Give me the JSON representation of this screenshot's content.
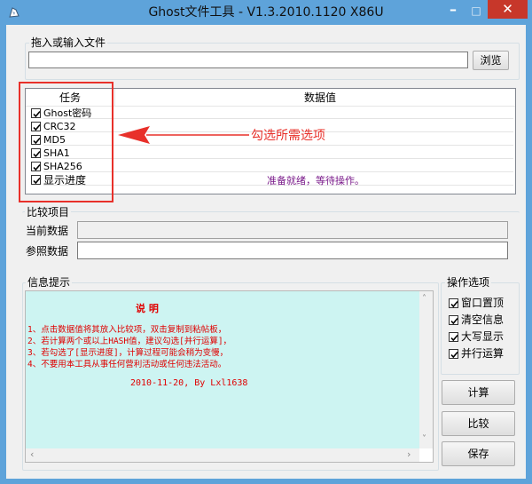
{
  "window": {
    "title": "Ghost文件工具 - V1.3.2010.1120 X86U",
    "minimize": "–",
    "maximize": "□",
    "close": "✕"
  },
  "file": {
    "group_label": "拖入或输入文件",
    "path_value": "",
    "browse_label": "浏览"
  },
  "task_list": {
    "col_task": "任务",
    "col_value": "数据值",
    "items": [
      {
        "label": "Ghost密码",
        "checked": true
      },
      {
        "label": "CRC32",
        "checked": true
      },
      {
        "label": "MD5",
        "checked": true
      },
      {
        "label": "SHA1",
        "checked": true
      },
      {
        "label": "SHA256",
        "checked": true
      },
      {
        "label": "显示进度",
        "checked": true
      }
    ],
    "status": "准备就绪，等待操作。"
  },
  "annotation": {
    "text": "勾选所需选项",
    "color": "#e8302a"
  },
  "compare": {
    "group_label": "比较项目",
    "current_label": "当前数据",
    "reference_label": "参照数据"
  },
  "info": {
    "group_label": "信息提示",
    "heading": "说 明",
    "lines": [
      "1、点击数据值将其放入比较项，双击复制到粘帖板，",
      "2、若计算两个或以上HASH值，建议勾选[并行运算]，",
      "3、若勾选了[显示进度]，计算过程可能会稍为变慢，",
      "4、不要用本工具从事任何营利活动或任何违法活动。"
    ],
    "footer": "2010-11-20, By Lxl1638",
    "background": "#cdf4f2"
  },
  "options": {
    "group_label": "操作选项",
    "items": [
      {
        "label": "窗口置顶",
        "checked": true
      },
      {
        "label": "清空信息",
        "checked": true
      },
      {
        "label": "大写显示",
        "checked": true
      },
      {
        "label": "并行运算",
        "checked": true
      }
    ]
  },
  "actions": {
    "compute": "计算",
    "compare": "比较",
    "save": "保存"
  }
}
